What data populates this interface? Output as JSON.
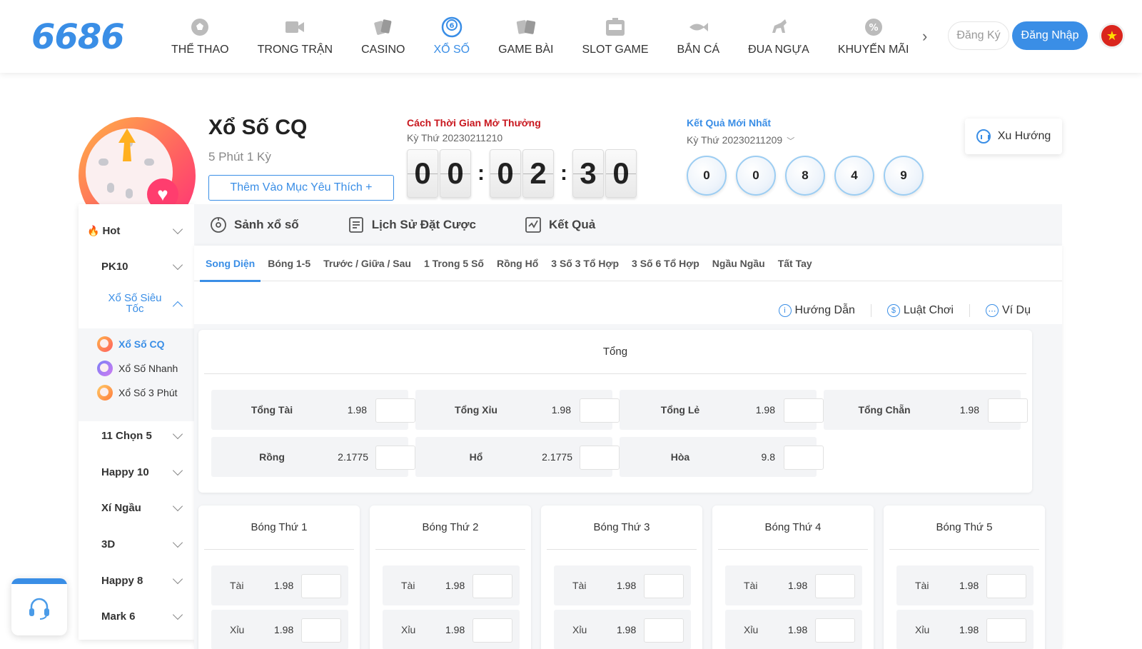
{
  "header": {
    "logo": "6686",
    "nav": [
      {
        "label": "THỂ THAO",
        "icon": "soccer-ball-icon"
      },
      {
        "label": "TRONG TRẬN",
        "icon": "video-camera-icon"
      },
      {
        "label": "CASINO",
        "icon": "playing-cards-icon"
      },
      {
        "label": "XỔ SỐ",
        "icon": "lottery-ball-icon",
        "active": true
      },
      {
        "label": "GAME BÀI",
        "icon": "card-game-icon"
      },
      {
        "label": "SLOT GAME",
        "icon": "slot-machine-icon"
      },
      {
        "label": "BẮN CÁ",
        "icon": "fish-icon"
      },
      {
        "label": "ĐUA NGỰA",
        "icon": "horse-icon"
      },
      {
        "label": "KHUYẾN MÃI",
        "icon": "discount-icon"
      }
    ],
    "register_label": "Đăng Ký",
    "login_label": "Đăng Nhập",
    "flag_icon": "vietnam-flag-icon"
  },
  "game": {
    "title": "Xổ Số CQ",
    "subtitle": "5 Phút 1 Kỳ",
    "favorite_label": "Thêm Vào Mục Yêu Thích +"
  },
  "countdown": {
    "title": "Cách Thời Gian Mở Thưởng",
    "period": "Kỳ Thứ 20230211210",
    "digits": [
      "0",
      "0",
      "0",
      "2",
      "3",
      "0"
    ]
  },
  "result": {
    "title": "Kết Quả Mới Nhất",
    "period": "Kỳ Thứ 20230211209",
    "balls": [
      "0",
      "0",
      "8",
      "4",
      "9"
    ]
  },
  "trend_label": "Xu Hướng",
  "sidebar": {
    "items": [
      {
        "label": "Hot"
      },
      {
        "label": "PK10"
      },
      {
        "label": "Xổ Số Siêu Tốc",
        "open": true
      },
      {
        "label": "11 Chọn 5"
      },
      {
        "label": "Happy 10"
      },
      {
        "label": "Xí Ngầu"
      },
      {
        "label": "3D"
      },
      {
        "label": "Happy 8"
      },
      {
        "label": "Mark 6"
      }
    ],
    "sub_items": [
      {
        "label": "Xổ Số CQ",
        "active": true
      },
      {
        "label": "Xổ Số Nhanh"
      },
      {
        "label": "Xổ Số 3 Phút"
      }
    ]
  },
  "main_tabs": [
    {
      "label": "Sảnh xổ số",
      "icon": "lottery-hall-icon"
    },
    {
      "label": "Lịch Sử Đặt Cược",
      "icon": "history-icon"
    },
    {
      "label": "Kết Quả",
      "icon": "result-chart-icon"
    }
  ],
  "bet_tabs": [
    "Song Diện",
    "Bóng 1-5",
    "Trước / Giữa / Sau",
    "1 Trong 5 Số",
    "Rồng Hổ",
    "3 Số 3 Tổ Hợp",
    "3 Số 6 Tổ Hợp",
    "Ngầu Ngầu",
    "Tất Tay"
  ],
  "help_links": [
    {
      "label": "Hướng Dẫn",
      "icon": "info-icon"
    },
    {
      "label": "Luật Chơi",
      "icon": "dollar-icon"
    },
    {
      "label": "Ví Dụ",
      "icon": "more-icon"
    }
  ],
  "total_card": {
    "title": "Tổng",
    "rows": [
      [
        {
          "label": "Tổng Tài",
          "odds": "1.98"
        },
        {
          "label": "Tổng Xỉu",
          "odds": "1.98"
        },
        {
          "label": "Tổng Lẻ",
          "odds": "1.98"
        },
        {
          "label": "Tổng Chẵn",
          "odds": "1.98"
        }
      ],
      [
        {
          "label": "Rồng",
          "odds": "2.1775"
        },
        {
          "label": "Hổ",
          "odds": "2.1775"
        },
        {
          "label": "Hòa",
          "odds": "9.8"
        }
      ]
    ]
  },
  "ball_cards": [
    {
      "title": "Bóng Thứ 1",
      "bets": [
        {
          "label": "Tài",
          "odds": "1.98"
        },
        {
          "label": "Xỉu",
          "odds": "1.98"
        }
      ]
    },
    {
      "title": "Bóng Thứ 2",
      "bets": [
        {
          "label": "Tài",
          "odds": "1.98"
        },
        {
          "label": "Xỉu",
          "odds": "1.98"
        }
      ]
    },
    {
      "title": "Bóng Thứ 3",
      "bets": [
        {
          "label": "Tài",
          "odds": "1.98"
        },
        {
          "label": "Xỉu",
          "odds": "1.98"
        }
      ]
    },
    {
      "title": "Bóng Thứ 4",
      "bets": [
        {
          "label": "Tài",
          "odds": "1.98"
        },
        {
          "label": "Xỉu",
          "odds": "1.98"
        }
      ]
    },
    {
      "title": "Bóng Thứ 5",
      "bets": [
        {
          "label": "Tài",
          "odds": "1.98"
        },
        {
          "label": "Xỉu",
          "odds": "1.98"
        }
      ]
    }
  ],
  "support_icon": "headset-icon",
  "colors": {
    "accent": "#3a8ee6",
    "countdown_title": "#c8161d",
    "flag": "#da251d"
  }
}
